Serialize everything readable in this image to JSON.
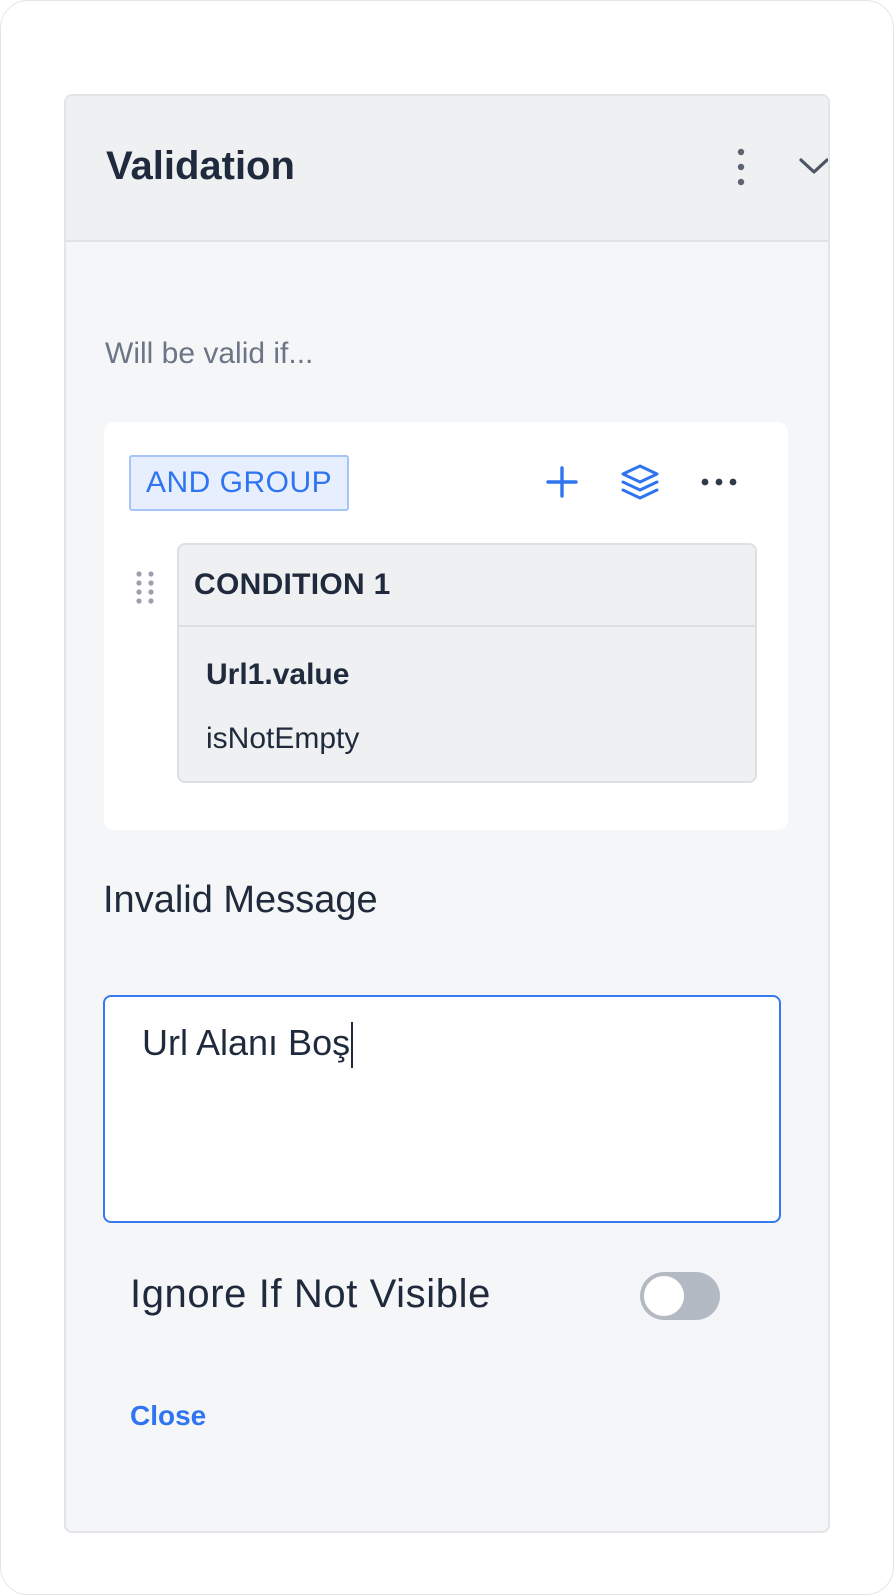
{
  "panel": {
    "title": "Validation",
    "menu_icon": "more-vertical-icon",
    "collapse_icon": "chevron-down-icon"
  },
  "rules": {
    "subtitle": "Will be valid if...",
    "group": {
      "label": "AND GROUP",
      "actions": [
        "plus-icon",
        "layers-icon",
        "more-horizontal-icon"
      ]
    },
    "conditions": [
      {
        "title": "CONDITION 1",
        "field": "Url1.value",
        "operator": "isNotEmpty"
      }
    ]
  },
  "invalid_message": {
    "label": "Invalid Message",
    "value": "Url Alanı Boş"
  },
  "ignore_if_not_visible": {
    "label": "Ignore If Not Visible",
    "checked": false
  },
  "footer": {
    "close_label": "Close"
  },
  "colors": {
    "accent": "#2f74f0",
    "chip_bg": "#e7efff",
    "panel_bg": "#f5f6f8",
    "toggle_off": "#b4bac3"
  }
}
